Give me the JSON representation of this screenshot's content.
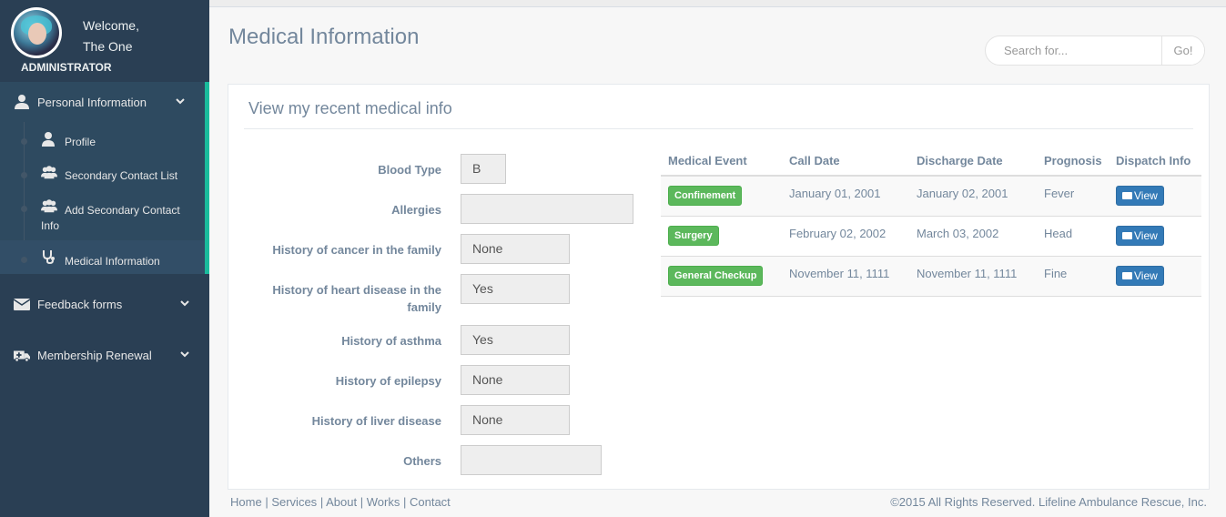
{
  "sidebar": {
    "welcome": "Welcome,",
    "username": "The One",
    "role": "ADMINISTRATOR",
    "nav": {
      "personal": "Personal Information",
      "feedback": "Feedback forms",
      "membership": "Membership Renewal"
    },
    "sub": {
      "profile": "Profile",
      "secondary": "Secondary Contact List",
      "add_secondary": "Add Secondary Contact Info",
      "medical": "Medical Information"
    },
    "accent": "#1abb9c"
  },
  "page": {
    "title": "Medical Information",
    "search_placeholder": "Search for...",
    "search_button": "Go!"
  },
  "panel": {
    "title": "View my recent medical info",
    "fields": {
      "blood_type": {
        "label": "Blood Type",
        "value": "B"
      },
      "allergies": {
        "label": "Allergies",
        "value": ""
      },
      "cancer": {
        "label": "History of cancer in the family",
        "value": "None"
      },
      "heart": {
        "label": "History of heart disease in the family",
        "value": "Yes"
      },
      "asthma": {
        "label": "History of asthma",
        "value": "Yes"
      },
      "epilepsy": {
        "label": "History of epilepsy",
        "value": "None"
      },
      "liver": {
        "label": "History of liver disease",
        "value": "None"
      },
      "others": {
        "label": "Others",
        "value": ""
      }
    }
  },
  "table": {
    "headers": {
      "event": "Medical Event",
      "call": "Call Date",
      "discharge": "Discharge Date",
      "prognosis": "Prognosis",
      "dispatch": "Dispatch Info"
    },
    "rows": [
      {
        "event": "Confinement",
        "call": "January 01, 2001",
        "discharge": "January 02, 2001",
        "prognosis": "Fever",
        "action": "View"
      },
      {
        "event": "Surgery",
        "call": "February 02, 2002",
        "discharge": "March 03, 2002",
        "prognosis": "Head",
        "action": "View"
      },
      {
        "event": "General Checkup",
        "call": "November 11, 1111",
        "discharge": "November 11, 1111",
        "prognosis": "Fine",
        "action": "View"
      }
    ]
  },
  "footer": {
    "home": "Home",
    "services": "Services",
    "about": "About",
    "works": "Works",
    "contact": "Contact",
    "sep": "|",
    "copyright": "©2015 All Rights Reserved. Lifeline Ambulance Rescue, Inc."
  }
}
